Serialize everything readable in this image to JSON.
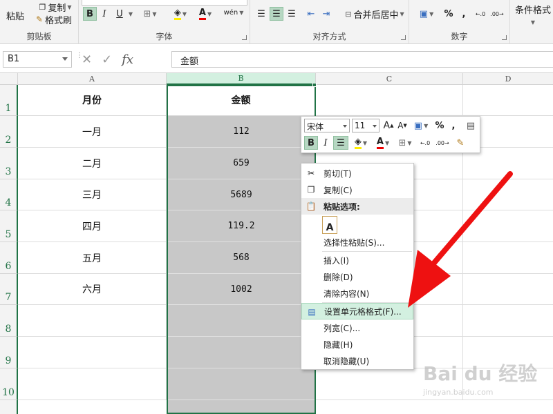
{
  "ribbon": {
    "clipboard": {
      "paste": "粘贴",
      "copy": "复制",
      "format_painter": "格式刷",
      "label": "剪贴板"
    },
    "font": {
      "bold": "B",
      "italic": "I",
      "underline": "U",
      "wen": "wén",
      "label": "字体"
    },
    "alignment": {
      "merge_center": "合并后居中",
      "label": "对齐方式"
    },
    "number": {
      "percent": "%",
      "comma": ",",
      "label": "数字"
    },
    "styles": {
      "conditional_format": "条件格式"
    }
  },
  "formula_bar": {
    "name_box": "B1",
    "fx": "fx",
    "content": "金额"
  },
  "columns": [
    "A",
    "B",
    "C",
    "D"
  ],
  "rows": [
    "1",
    "2",
    "3",
    "4",
    "5",
    "6",
    "7",
    "8",
    "9",
    "10"
  ],
  "table": {
    "header": {
      "month": "月份",
      "amount": "金额"
    },
    "data": [
      {
        "month": "一月",
        "amount": "112"
      },
      {
        "month": "二月",
        "amount": "659"
      },
      {
        "month": "三月",
        "amount": "5689"
      },
      {
        "month": "四月",
        "amount": "119.2"
      },
      {
        "month": "五月",
        "amount": "568"
      },
      {
        "month": "六月",
        "amount": "1002"
      }
    ]
  },
  "mini_toolbar": {
    "font_name": "宋体",
    "font_size": "11",
    "grow": "A",
    "shrink": "A",
    "percent": "%",
    "comma": ",",
    "bold": "B",
    "italic": "I",
    "font_color": "A"
  },
  "context_menu": {
    "cut": "剪切(T)",
    "copy": "复制(C)",
    "paste_options": "粘贴选项:",
    "paste_special": "选择性粘贴(S)...",
    "insert": "插入(I)",
    "delete": "删除(D)",
    "clear": "清除内容(N)",
    "format_cells": "设置单元格格式(F)...",
    "col_width": "列宽(C)...",
    "hide": "隐藏(H)",
    "unhide": "取消隐藏(U)"
  },
  "watermark": {
    "brand": "Bai du 经验",
    "url": "jingyan.baidu.com"
  },
  "colors": {
    "accent": "#217346",
    "selection": "#c8c8c8",
    "arrow": "#ee1111"
  }
}
